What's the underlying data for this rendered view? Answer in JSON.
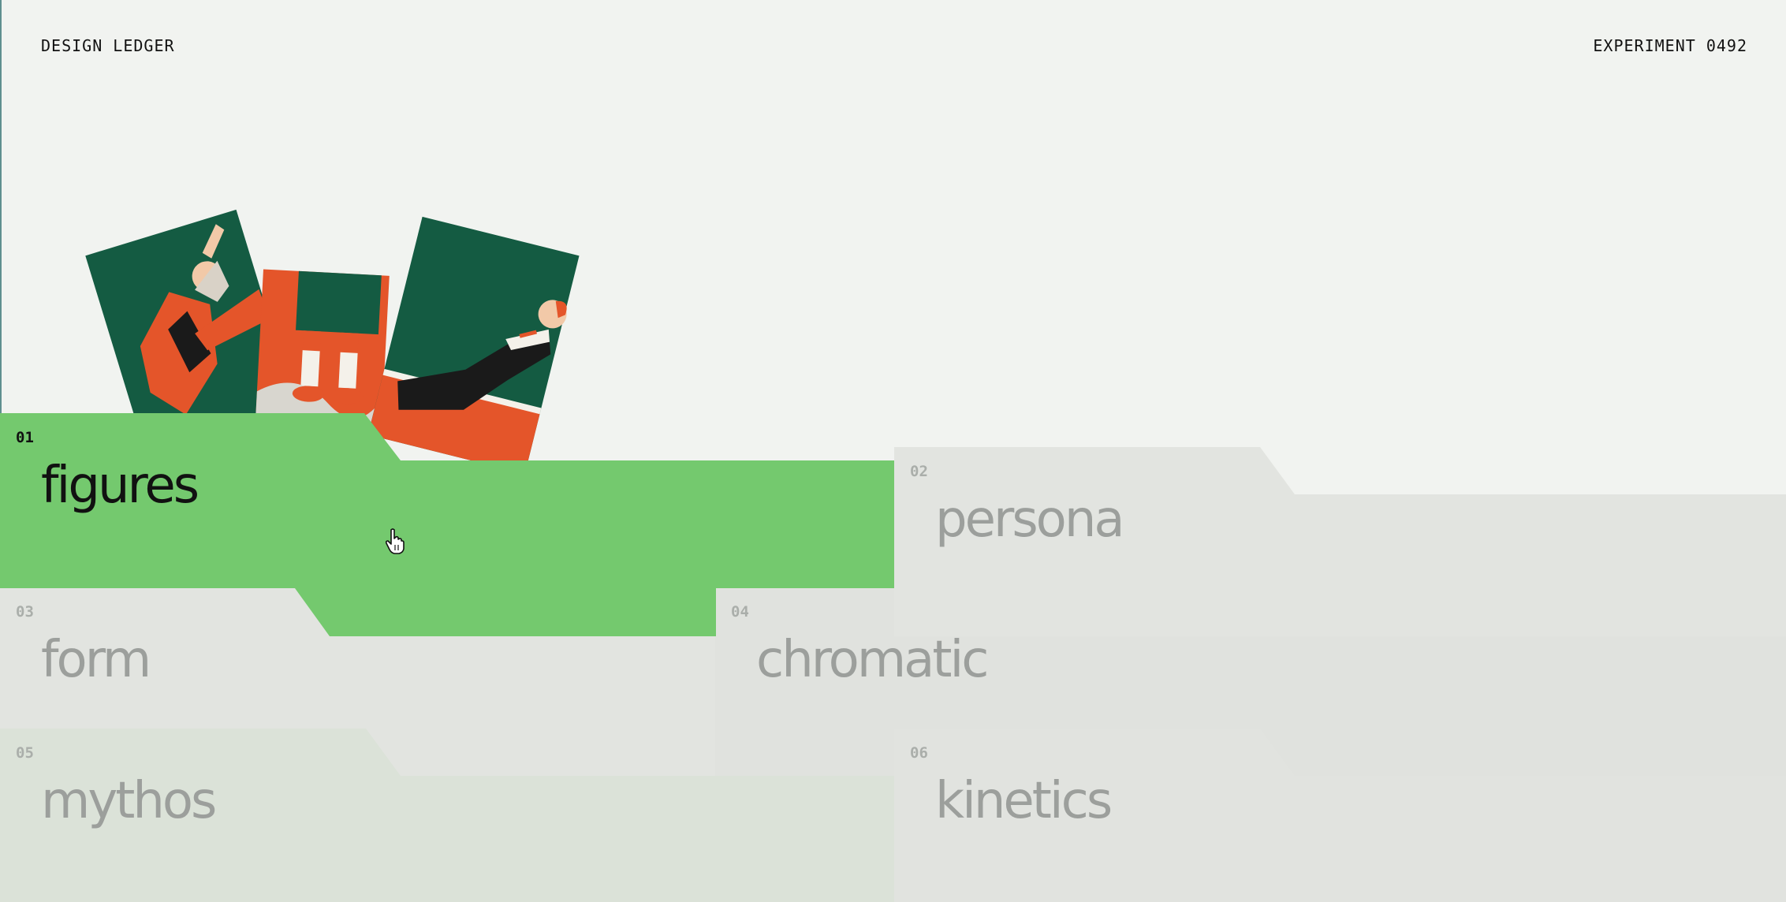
{
  "header": {
    "brand": "DESIGN LEDGER",
    "experiment": "EXPERIMENT 0492"
  },
  "tiles": [
    {
      "num": "01",
      "label": "figures",
      "active": true
    },
    {
      "num": "02",
      "label": "persona",
      "active": false
    },
    {
      "num": "03",
      "label": "form",
      "active": false
    },
    {
      "num": "04",
      "label": "chromatic",
      "active": false
    },
    {
      "num": "05",
      "label": "mythos",
      "active": false
    },
    {
      "num": "06",
      "label": "kinetics",
      "active": false
    }
  ],
  "colors": {
    "background": "#f1f3f0",
    "active_tile": "#74c96e",
    "inactive_tile": "#e2e4e0",
    "tile_05": "#dbe2d8",
    "label_inactive": "#9c9f9c",
    "illustration_green": "#145b42",
    "illustration_orange": "#e4552a"
  },
  "icons": {
    "cursor": "hand-pointer-icon"
  }
}
